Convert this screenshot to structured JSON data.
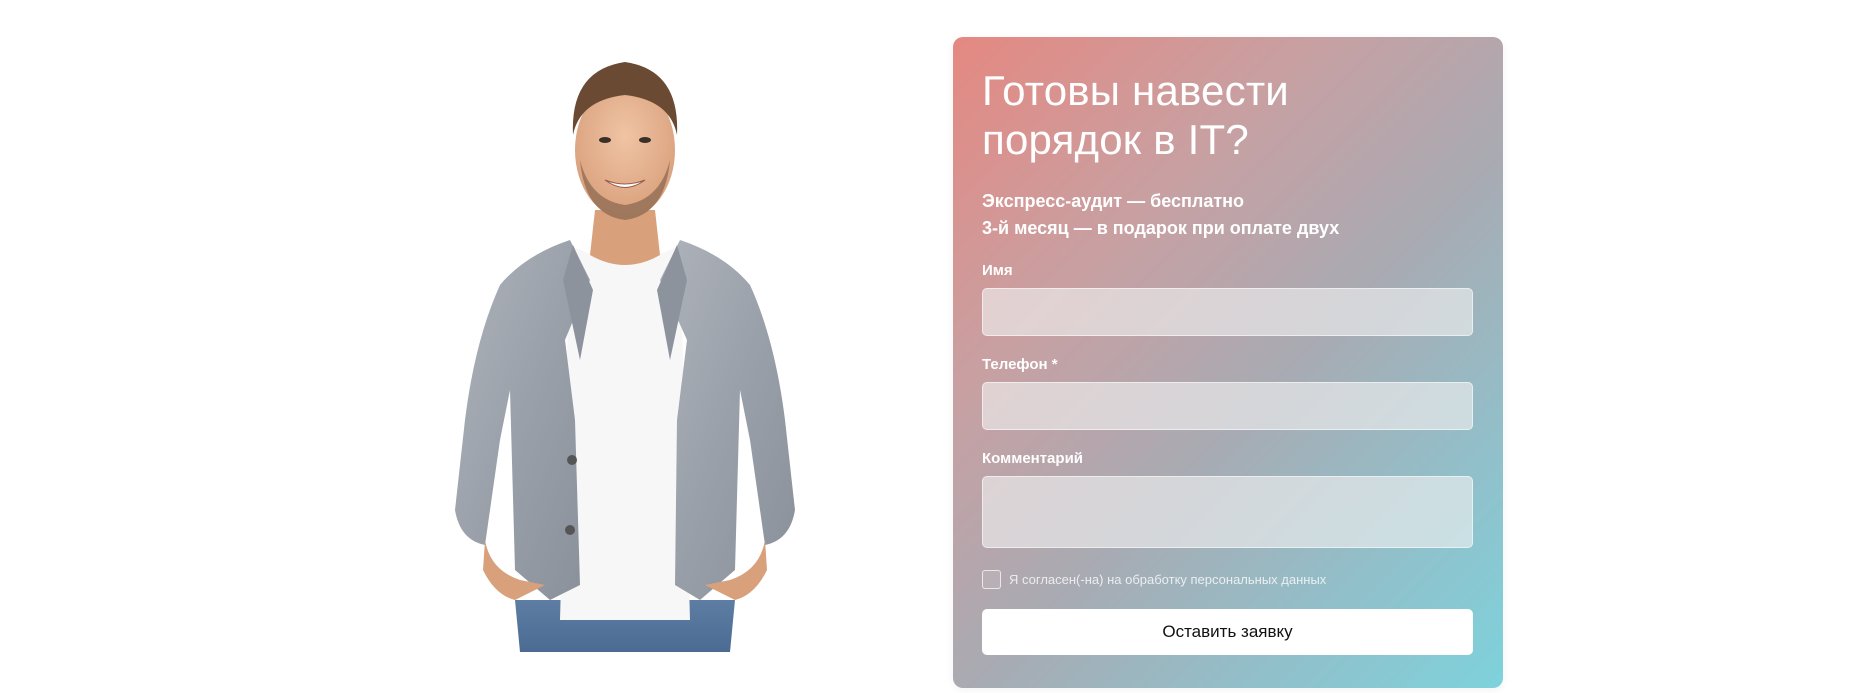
{
  "form": {
    "title": "Готовы навести порядок в IT?",
    "offers": [
      "Экспресс-аудит — бесплатно",
      "3-й месяц — в подарок при оплате двух"
    ],
    "fields": {
      "name_label": "Имя",
      "name_value": "",
      "phone_label": "Телефон *",
      "phone_value": "",
      "comment_label": "Комментарий",
      "comment_value": ""
    },
    "consent_text": "Я согласен(-на) на обработку персональных данных",
    "consent_checked": false,
    "submit_label": "Оставить заявку"
  },
  "colors": {
    "card_gradient_start": "#e58881",
    "card_gradient_end": "#7ed2dc",
    "button_bg": "#ffffff"
  },
  "image": {
    "subject": "smiling man in grey blazer and white t-shirt"
  }
}
